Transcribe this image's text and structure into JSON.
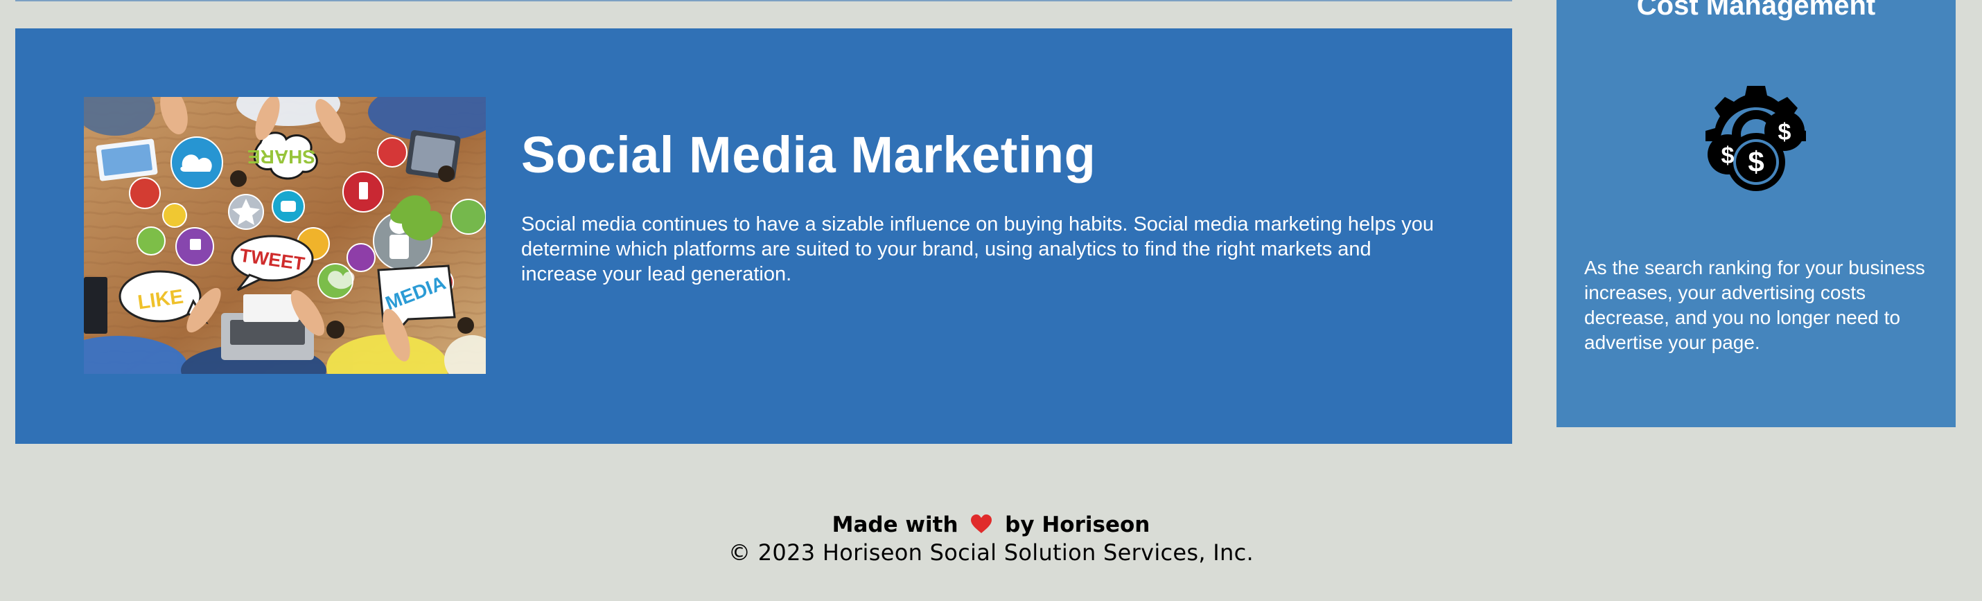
{
  "service": {
    "title": "Social Media Marketing",
    "description": "Social media continues to have a sizable influence on buying habits. Social media marketing helps you determine which platforms are suited to your brand, using analytics to find the right markets and increase your lead generation.",
    "image_labels": {
      "share": "SHARE",
      "tweet": "TWEET",
      "like": "LIKE",
      "media": "MEDIA"
    }
  },
  "benefit": {
    "title": "Cost Management",
    "icon": "cost-management-icon",
    "description": "As the search ranking for your business increases, your advertising costs decrease, and you no longer need to advertise your page."
  },
  "footer": {
    "made_prefix": "Made with",
    "heart_icon": "heart-icon",
    "made_suffix": "by Horiseon",
    "copyright": "© 2023 Horiseon Social Solution Services, Inc."
  },
  "colors": {
    "background": "#d9dcd6",
    "service_card": "#3071b6",
    "benefit_card": "#4585bd",
    "text_light": "#ffffff",
    "heart": "#e02b2b"
  }
}
